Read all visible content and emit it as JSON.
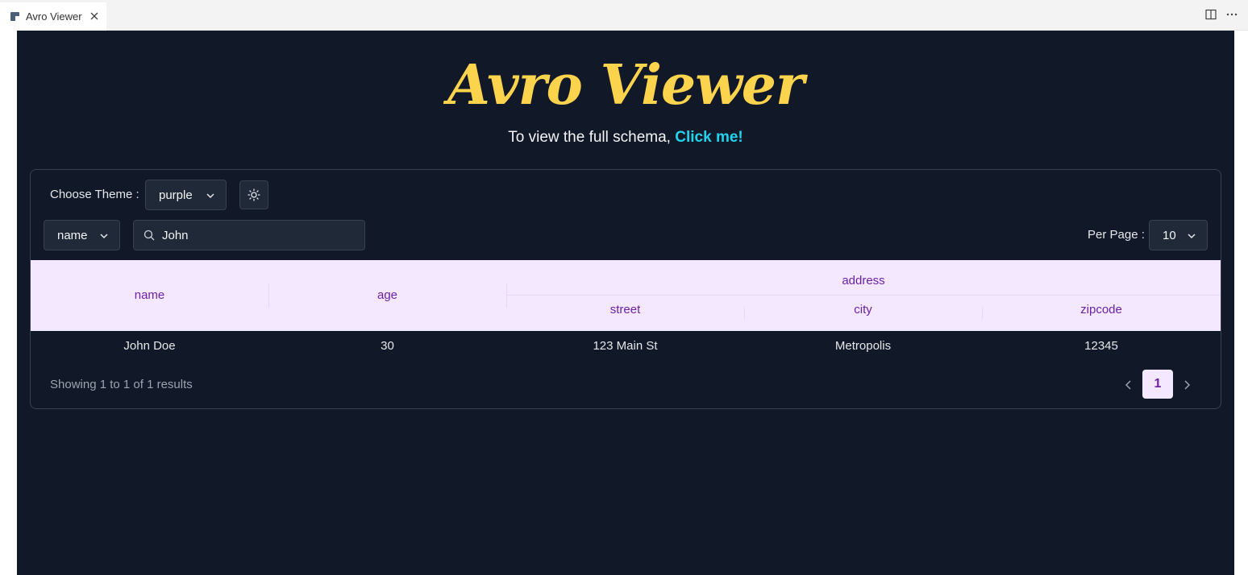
{
  "tab": {
    "title": "Avro Viewer"
  },
  "header": {
    "title": "Avro Viewer",
    "subtitle_prefix": "To view the full schema, ",
    "subtitle_link": "Click me!"
  },
  "controls": {
    "theme_label": "Choose Theme :",
    "theme_value": "purple",
    "theme_toggle_icon": "sun-icon",
    "filter_field": "name",
    "search_value": "John",
    "per_page_label": "Per Page :",
    "per_page_value": "10"
  },
  "table": {
    "columns": [
      "name",
      "age"
    ],
    "group_header": "address",
    "group_columns": [
      "street",
      "city",
      "zipcode"
    ],
    "rows": [
      [
        "John Doe",
        "30",
        "123 Main St",
        "Metropolis",
        "12345"
      ]
    ]
  },
  "pagination": {
    "summary": "Showing 1 to 1 of 1 results",
    "current_page": "1"
  },
  "colors": {
    "background": "#111827",
    "title": "#fcd34d",
    "link": "#22d3ee",
    "header_bg": "#f3e8ff",
    "header_text": "#6b21a8"
  }
}
